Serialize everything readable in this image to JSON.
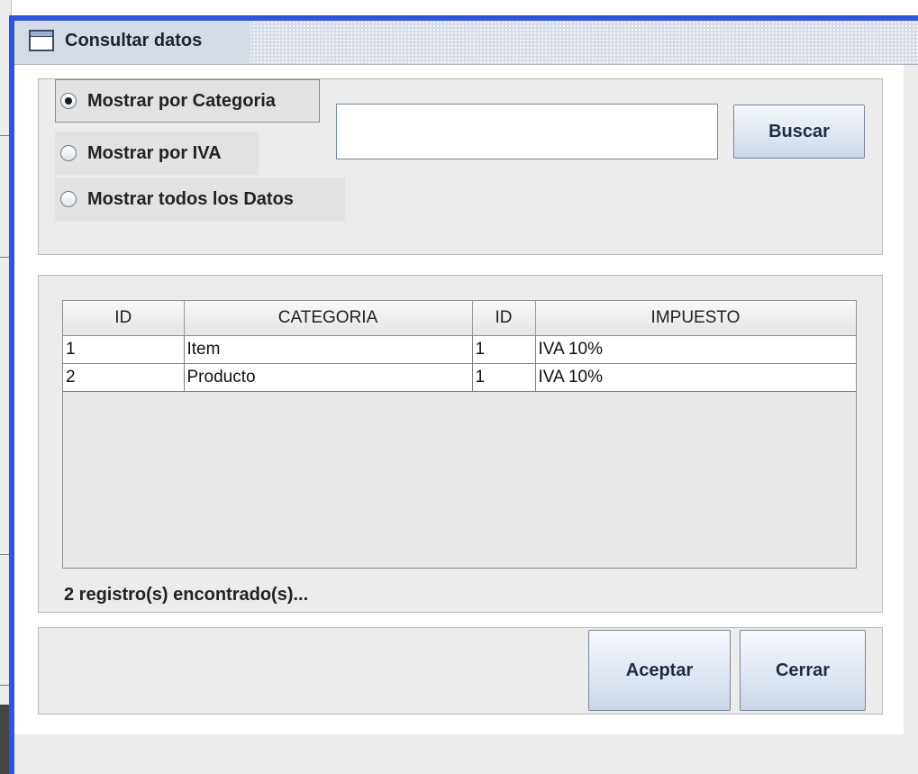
{
  "window": {
    "title": "Consultar datos"
  },
  "search": {
    "options": [
      {
        "label": "Mostrar por Categoria",
        "checked": true
      },
      {
        "label": "Mostrar por IVA",
        "checked": false
      },
      {
        "label": "Mostrar todos los Datos",
        "checked": false
      }
    ],
    "input_value": "",
    "search_button": "Buscar"
  },
  "table": {
    "columns": [
      "ID",
      "CATEGORIA",
      "ID",
      "IMPUESTO"
    ],
    "rows": [
      [
        "1",
        "Item",
        "1",
        "IVA 10%"
      ],
      [
        "2",
        "Producto",
        "1",
        "IVA 10%"
      ]
    ]
  },
  "status": {
    "records_text": "2 registro(s) encontrado(s)..."
  },
  "footer": {
    "accept_button": "Aceptar",
    "close_button": "Cerrar"
  },
  "colors": {
    "window_frame": "#2f55d8",
    "panel_bg": "#ececec",
    "button_text": "#1f2d44"
  }
}
